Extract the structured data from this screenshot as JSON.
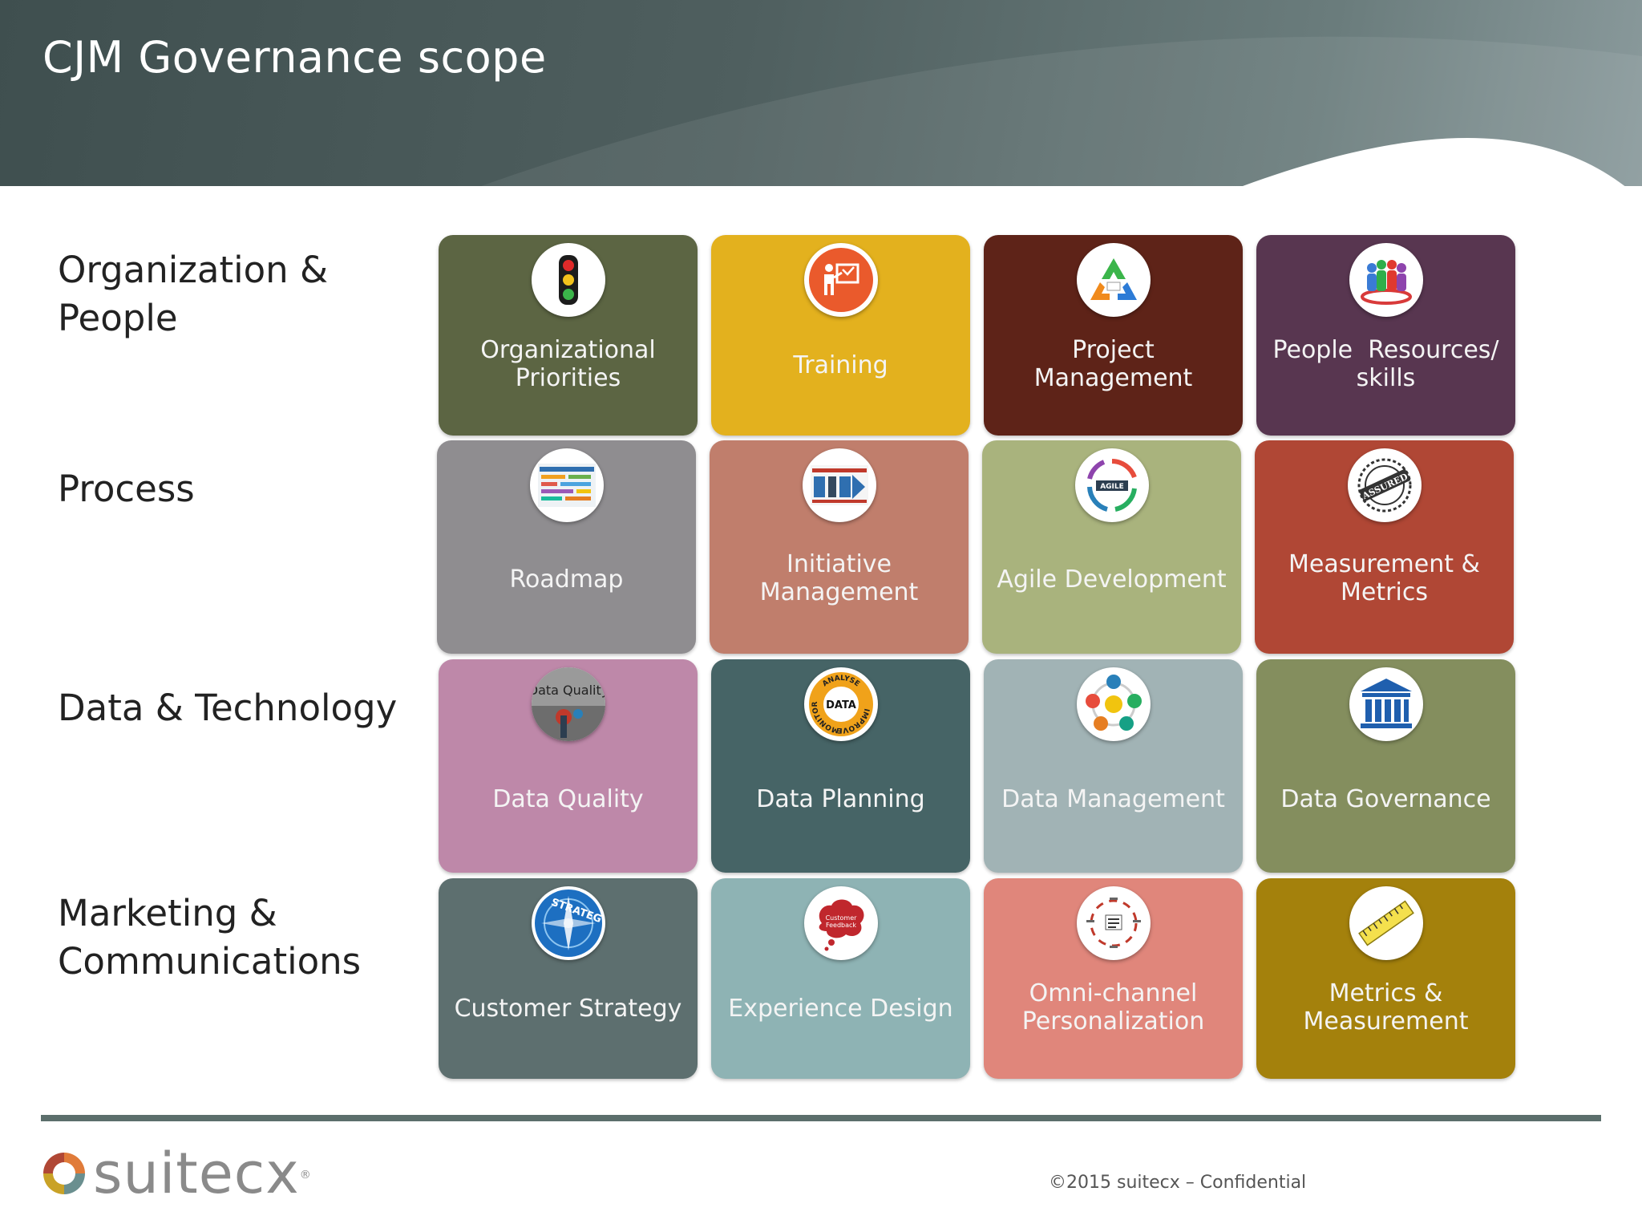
{
  "header": {
    "title": "CJM Governance scope"
  },
  "rows": [
    {
      "label": "Organization &\nPeople"
    },
    {
      "label": "Process"
    },
    {
      "label": "Data & Technology"
    },
    {
      "label": "Marketing &\nCommunications"
    }
  ],
  "tiles": [
    {
      "label": "Organizational\nPriorities",
      "color": "#5c6543",
      "icon": "traffic-light-icon"
    },
    {
      "label": "Training",
      "color": "#e3b11e",
      "icon": "presentation-board-icon"
    },
    {
      "label": "Project\nManagement",
      "color": "#5e2318",
      "icon": "recycle-triangle-icon"
    },
    {
      "label": "People  Resources/\nskills",
      "color": "#583650",
      "icon": "people-group-icon"
    },
    {
      "label": "Roadmap",
      "color": "#8f8d90",
      "icon": "roadmap-chart-icon"
    },
    {
      "label": "Initiative\nManagement",
      "color": "#c07e6c",
      "icon": "initiative-chart-icon"
    },
    {
      "label": "Agile Development",
      "color": "#a9b37d",
      "icon": "agile-cycle-icon"
    },
    {
      "label": "Measurement &\nMetrics",
      "color": "#b04735",
      "icon": "assured-stamp-icon"
    },
    {
      "label": "Data Quality",
      "color": "#be88a9",
      "icon": "data-quality-icon"
    },
    {
      "label": "Data Planning",
      "color": "#466466",
      "icon": "data-cycle-icon"
    },
    {
      "label": "Data Management",
      "color": "#a1b3b5",
      "icon": "data-management-icon"
    },
    {
      "label": "Data Governance",
      "color": "#848e5e",
      "icon": "governance-building-icon"
    },
    {
      "label": "Customer Strategy",
      "color": "#5d6f6f",
      "icon": "compass-strategy-icon"
    },
    {
      "label": "Experience Design",
      "color": "#8eb3b4",
      "icon": "feedback-bubble-icon"
    },
    {
      "label": "Omni-channel\nPersonalization",
      "color": "#e0867b",
      "icon": "channel-cycle-icon"
    },
    {
      "label": "Metrics &\nMeasurement",
      "color": "#a4810c",
      "icon": "ruler-icon"
    }
  ],
  "icon_texts": {
    "agile": "AGILE",
    "assured": "ASSURED",
    "data_quality": "Data Quality",
    "data": "DATA",
    "analyse": "ANALYSE",
    "improve": "IMPROVE",
    "monitor": "MONITOR",
    "strategy": "STRATEG",
    "customer_feedback": "Customer\nFeedback"
  },
  "footer": {
    "logo_text": "suitecx",
    "logo_mark": "®",
    "copyright": "©2015 suitecx – Confidential"
  }
}
